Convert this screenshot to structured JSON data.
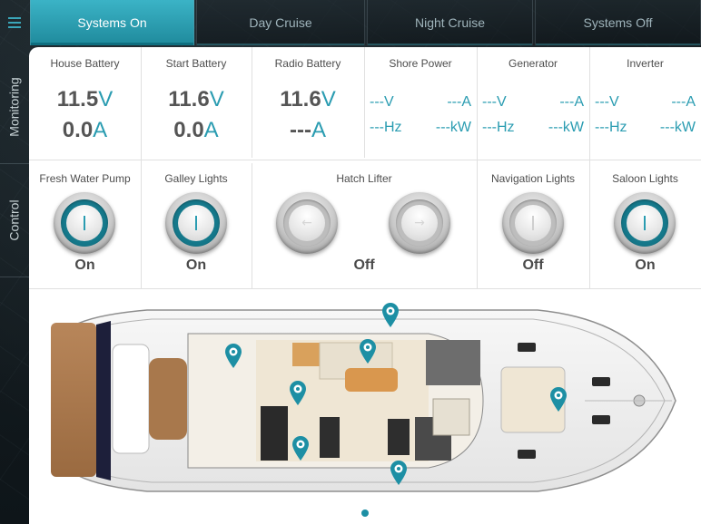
{
  "tabs": [
    {
      "label": "Systems On",
      "active": true
    },
    {
      "label": "Day Cruise",
      "active": false
    },
    {
      "label": "Night Cruise",
      "active": false
    },
    {
      "label": "Systems Off",
      "active": false
    }
  ],
  "menu_icon": "hamburger-menu-icon",
  "side_tabs": {
    "monitoring": "Monitoring",
    "control": "Control"
  },
  "monitoring": {
    "house_battery": {
      "title": "House Battery",
      "voltage": "11.5",
      "current": "0.0",
      "v_unit": "V",
      "a_unit": "A"
    },
    "start_battery": {
      "title": "Start Battery",
      "voltage": "11.6",
      "current": "0.0",
      "v_unit": "V",
      "a_unit": "A"
    },
    "radio_battery": {
      "title": "Radio Battery",
      "voltage": "11.6",
      "current": "---",
      "v_unit": "V",
      "a_unit": "A"
    },
    "shore_power": {
      "title": "Shore Power",
      "v": "---V",
      "a": "---A",
      "hz": "---Hz",
      "kw": "---kW"
    },
    "generator": {
      "title": "Generator",
      "v": "---V",
      "a": "---A",
      "hz": "---Hz",
      "kw": "---kW"
    },
    "inverter": {
      "title": "Inverter",
      "v": "---V",
      "a": "---A",
      "hz": "---Hz",
      "kw": "---kW"
    }
  },
  "control": {
    "fresh_water_pump": {
      "title": "Fresh Water Pump",
      "state": "On"
    },
    "galley_lights": {
      "title": "Galley Lights",
      "state": "On"
    },
    "hatch_lifter": {
      "title": "Hatch Lifter",
      "state": "Off"
    },
    "navigation_lights": {
      "title": "Navigation Lights",
      "state": "Off"
    },
    "saloon_lights": {
      "title": "Saloon Lights",
      "state": "On"
    }
  },
  "colors": {
    "accent": "#2a9cb1",
    "tab_active": "#3bb3c6"
  },
  "pagination": {
    "pages": 1,
    "current": 1
  }
}
